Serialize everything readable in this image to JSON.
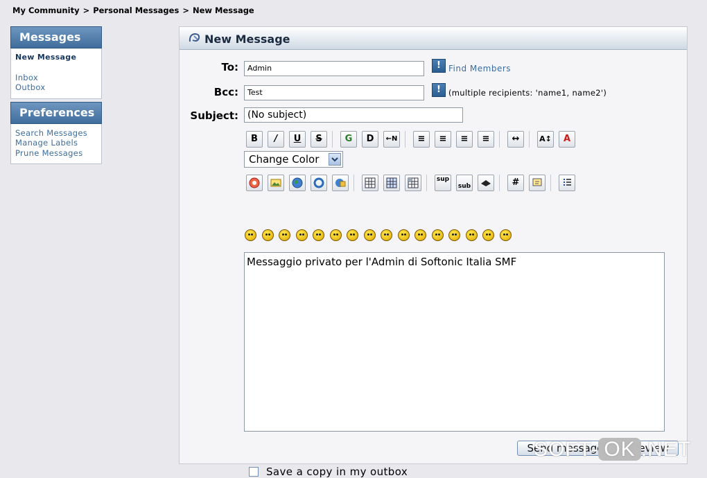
{
  "breadcrumb": {
    "items": [
      "My Community",
      "Personal Messages",
      "New Message"
    ],
    "separator": ">"
  },
  "sidebar": {
    "messages_title": "Messages",
    "messages_items": [
      "New Message",
      "Inbox",
      "Outbox"
    ],
    "preferences_title": "Preferences",
    "preferences_items": [
      "Search Messages",
      "Manage Labels",
      "Prune Messages"
    ]
  },
  "panel": {
    "title": "New Message"
  },
  "form": {
    "to_label": "To:",
    "to_value": "Admin",
    "find_members": "Find Members",
    "bcc_label": "Bcc:",
    "bcc_value": "Test",
    "bcc_hint": "(multiple recipients: 'name1, name2')",
    "subject_label": "Subject:",
    "subject_value": "(No subject)",
    "lookup_glyph": "!",
    "message": "Messaggio privato per l'Admin di Softonic Italia SMF",
    "send_label": "Send message",
    "preview_label": "Preview",
    "save_copy_label": "Save a copy in my outbox",
    "save_copy_checked": false
  },
  "toolbar": {
    "row1": [
      {
        "icon": "bold-icon",
        "glyph": "B"
      },
      {
        "icon": "italic-icon",
        "glyph": "/"
      },
      {
        "icon": "underline-icon",
        "glyph": "U"
      },
      {
        "icon": "strikethrough-icon",
        "glyph": "S"
      },
      {
        "icon": "glow-icon",
        "glyph": "G"
      },
      {
        "icon": "shadow-icon",
        "glyph": "D"
      },
      {
        "icon": "move-icon",
        "glyph": "←N"
      },
      {
        "icon": "preformatted-icon",
        "glyph": "≡"
      },
      {
        "icon": "align-left-icon",
        "glyph": "≡"
      },
      {
        "icon": "align-center-icon",
        "glyph": "≡"
      },
      {
        "icon": "align-right-icon",
        "glyph": "≡"
      },
      {
        "icon": "horizontal-rule-icon",
        "glyph": "↔"
      },
      {
        "icon": "font-size-icon",
        "glyph": "A↕"
      },
      {
        "icon": "font-face-icon",
        "glyph": "A"
      }
    ],
    "color_select": "Change Color",
    "row2": [
      {
        "icon": "flash-icon"
      },
      {
        "icon": "image-icon"
      },
      {
        "icon": "hyperlink-icon"
      },
      {
        "icon": "email-icon"
      },
      {
        "icon": "ftp-icon"
      },
      {
        "icon": "table-icon"
      },
      {
        "icon": "table-row-icon"
      },
      {
        "icon": "table-column-icon"
      },
      {
        "icon": "superscript-icon",
        "glyph": "sup"
      },
      {
        "icon": "subscript-icon",
        "glyph": "sub"
      },
      {
        "icon": "teletype-icon"
      },
      {
        "icon": "code-icon",
        "glyph": "#"
      },
      {
        "icon": "quote-icon"
      },
      {
        "icon": "list-icon"
      }
    ],
    "smiley_count": 16
  },
  "watermark": {
    "left": "SOFT-",
    "ok": "OK",
    "right": ".NET"
  },
  "colors": {
    "sidebar_header": "#3f6d9c",
    "link": "#3c6d9e",
    "background": "#e9e9ed"
  }
}
